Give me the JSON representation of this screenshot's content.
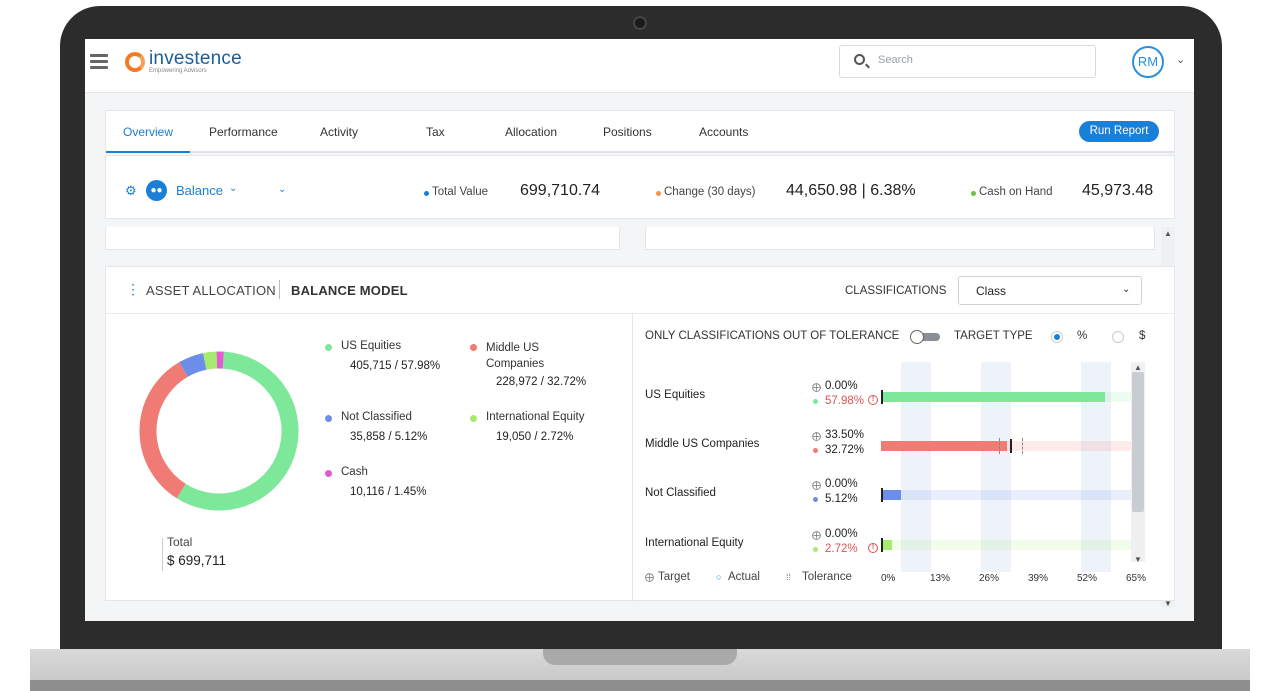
{
  "app": {
    "logo_name": "investence",
    "logo_tagline": "Empowering Advisors"
  },
  "search": {
    "placeholder": "Search"
  },
  "user": {
    "initials": "RM"
  },
  "tabs": [
    {
      "label": "Overview",
      "active": true
    },
    {
      "label": "Performance"
    },
    {
      "label": "Activity"
    },
    {
      "label": "Tax"
    },
    {
      "label": "Allocation"
    },
    {
      "label": "Positions"
    },
    {
      "label": "Accounts"
    }
  ],
  "actions": {
    "run_report": "Run Report"
  },
  "summary": {
    "model": "Balance",
    "total_value_label": "Total Value",
    "total_value": "699,710.74",
    "change_label": "Change (30 days)",
    "change_value": "44,650.98 | 6.38%",
    "cash_label": "Cash on Hand",
    "cash_value": "45,973.48",
    "colors": {
      "total": "#1a7fd6",
      "change": "#f5924a",
      "cash": "#6cc04a"
    }
  },
  "allocation": {
    "title": "ASSET ALLOCATION",
    "model": "BALANCE MODEL",
    "classifications_label": "CLASSIFICATIONS",
    "classification_selected": "Class",
    "total_label": "Total",
    "total_value": "$ 699,711",
    "legend": [
      {
        "name": "US Equities",
        "value": "405,715 / 57.98%",
        "color": "#7ee89a"
      },
      {
        "name": "Middle US Companies",
        "value": "228,972 / 32.72%",
        "color": "#ef7b74"
      },
      {
        "name": "Not Classified",
        "value": "35,858 / 5.12%",
        "color": "#6d8ee8"
      },
      {
        "name": "International Equity",
        "value": "19,050 / 2.72%",
        "color": "#a6eb6f"
      },
      {
        "name": "Cash",
        "value": "10,116 / 1.45%",
        "color": "#e45ad0"
      }
    ]
  },
  "tolerance": {
    "header": "ONLY CLASSIFICATIONS OUT OF TOLERANCE",
    "target_type_label": "TARGET TYPE",
    "opt_percent": "%",
    "opt_dollar": "$",
    "legend_target": "Target",
    "legend_actual": "Actual",
    "legend_tolerance": "Tolerance",
    "axis_ticks": [
      "0%",
      "13%",
      "26%",
      "39%",
      "52%",
      "65%"
    ],
    "rows": [
      {
        "name": "US Equities",
        "target": "0.00%",
        "actual": "57.98%",
        "target_pct": 0.0,
        "actual_pct": 57.98,
        "warn": true
      },
      {
        "name": "Middle US Companies",
        "target": "33.50%",
        "actual": "32.72%",
        "target_pct": 33.5,
        "actual_pct": 32.72,
        "warn": false
      },
      {
        "name": "Not Classified",
        "target": "0.00%",
        "actual": "5.12%",
        "target_pct": 0.0,
        "actual_pct": 5.12,
        "warn": false
      },
      {
        "name": "International Equity",
        "target": "0.00%",
        "actual": "2.72%",
        "target_pct": 0.0,
        "actual_pct": 2.72,
        "warn": true
      }
    ]
  },
  "chart_data": {
    "type": "pie",
    "categories": [
      "US Equities",
      "Middle US Companies",
      "Not Classified",
      "International Equity",
      "Cash"
    ],
    "values": [
      57.98,
      32.72,
      5.12,
      2.72,
      1.45
    ],
    "title": "",
    "xlabel": "",
    "ylabel": ""
  }
}
